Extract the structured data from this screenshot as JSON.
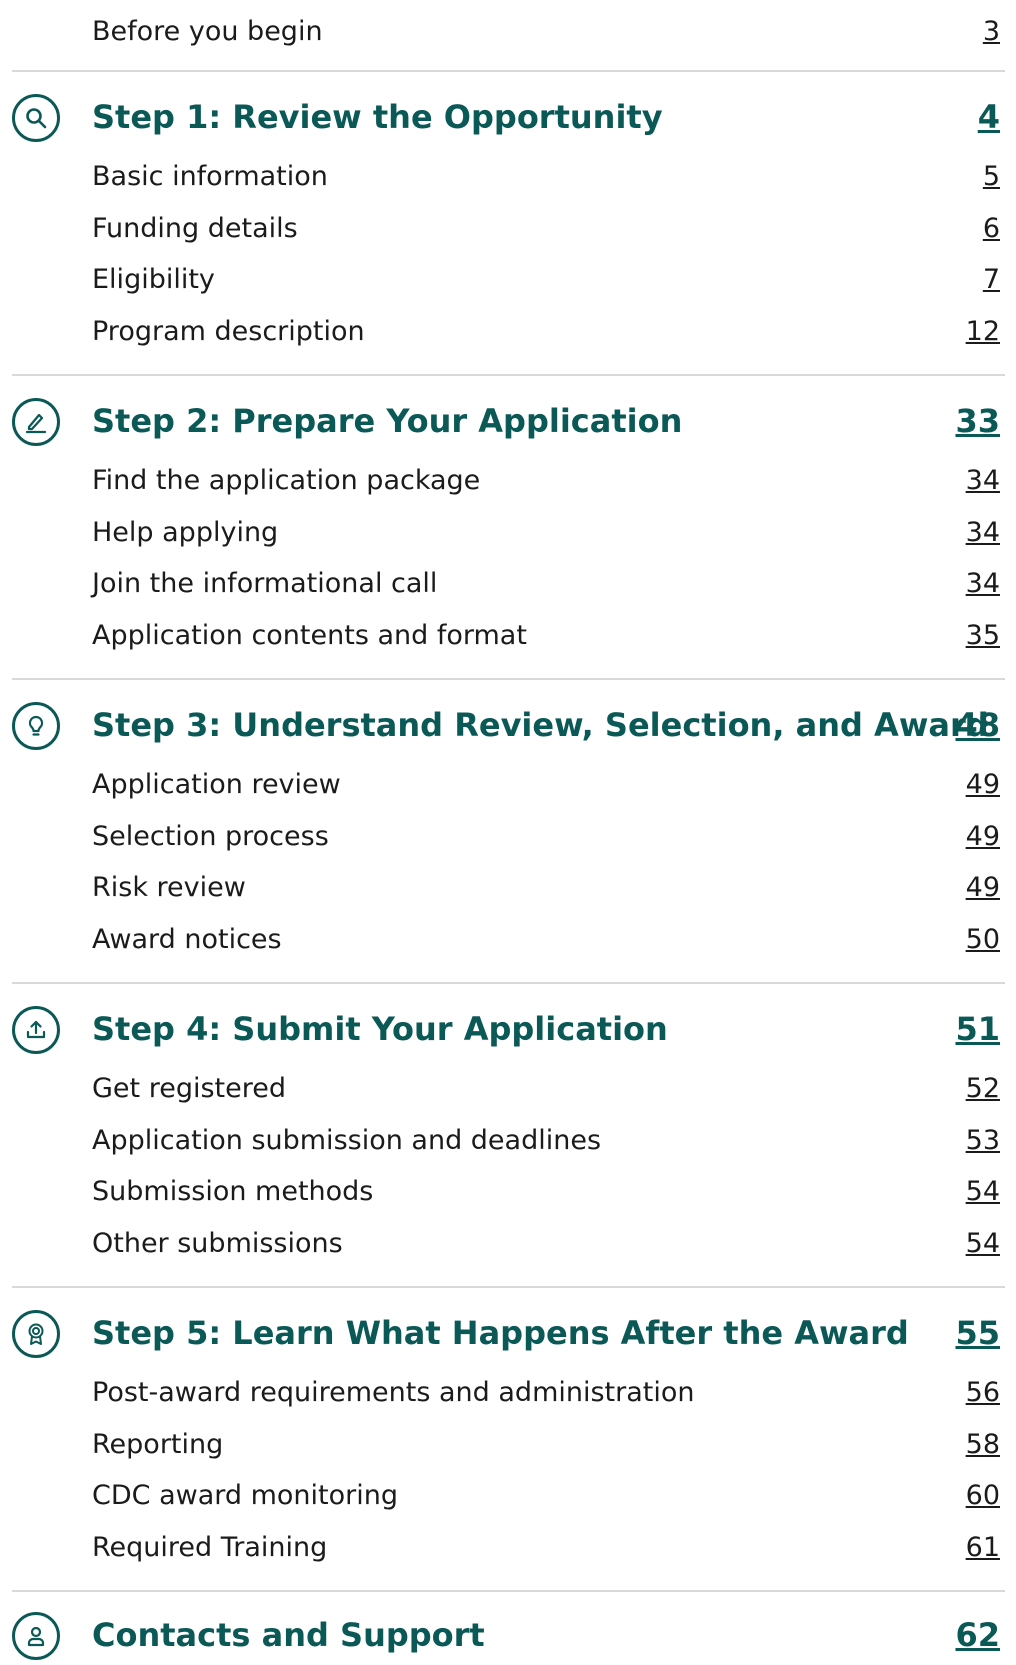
{
  "intro": {
    "label": "Before you begin",
    "page": "3"
  },
  "steps": [
    {
      "title": "Step 1: Review the Opportunity",
      "page": "4",
      "icon": "search-icon",
      "items": [
        {
          "label": "Basic information",
          "page": "5"
        },
        {
          "label": "Funding details",
          "page": "6"
        },
        {
          "label": "Eligibility",
          "page": "7"
        },
        {
          "label": "Program description",
          "page": "12"
        }
      ]
    },
    {
      "title": "Step 2: Prepare Your Application",
      "page": "33",
      "icon": "pencil-icon",
      "items": [
        {
          "label": "Find the application package",
          "page": "34"
        },
        {
          "label": "Help applying",
          "page": "34"
        },
        {
          "label": "Join the informational call",
          "page": "34"
        },
        {
          "label": "Application contents and format",
          "page": "35"
        }
      ]
    },
    {
      "title": "Step 3: Understand Review, Selection, and Award",
      "page": "48",
      "icon": "lightbulb-icon",
      "items": [
        {
          "label": "Application review",
          "page": "49"
        },
        {
          "label": "Selection process",
          "page": "49"
        },
        {
          "label": "Risk review",
          "page": "49"
        },
        {
          "label": "Award notices",
          "page": "50"
        }
      ]
    },
    {
      "title": "Step 4: Submit Your Application",
      "page": "51",
      "icon": "upload-icon",
      "items": [
        {
          "label": "Get registered",
          "page": "52"
        },
        {
          "label": "Application submission and deadlines",
          "page": "53"
        },
        {
          "label": "Submission methods",
          "page": "54"
        },
        {
          "label": "Other submissions",
          "page": "54"
        }
      ]
    },
    {
      "title": "Step 5: Learn What Happens After the Award",
      "page": "55",
      "icon": "award-ribbon-icon",
      "items": [
        {
          "label": "Post-award requirements and administration",
          "page": "56"
        },
        {
          "label": "Reporting",
          "page": "58"
        },
        {
          "label": "CDC award monitoring",
          "page": "60"
        },
        {
          "label": "Required Training",
          "page": "61"
        }
      ]
    },
    {
      "title": "Contacts and Support",
      "page": "62",
      "icon": "person-icon",
      "items": []
    }
  ],
  "colors": {
    "accent": "#0b5957",
    "divider": "#d9d9d9",
    "text": "#1b1b1b"
  }
}
